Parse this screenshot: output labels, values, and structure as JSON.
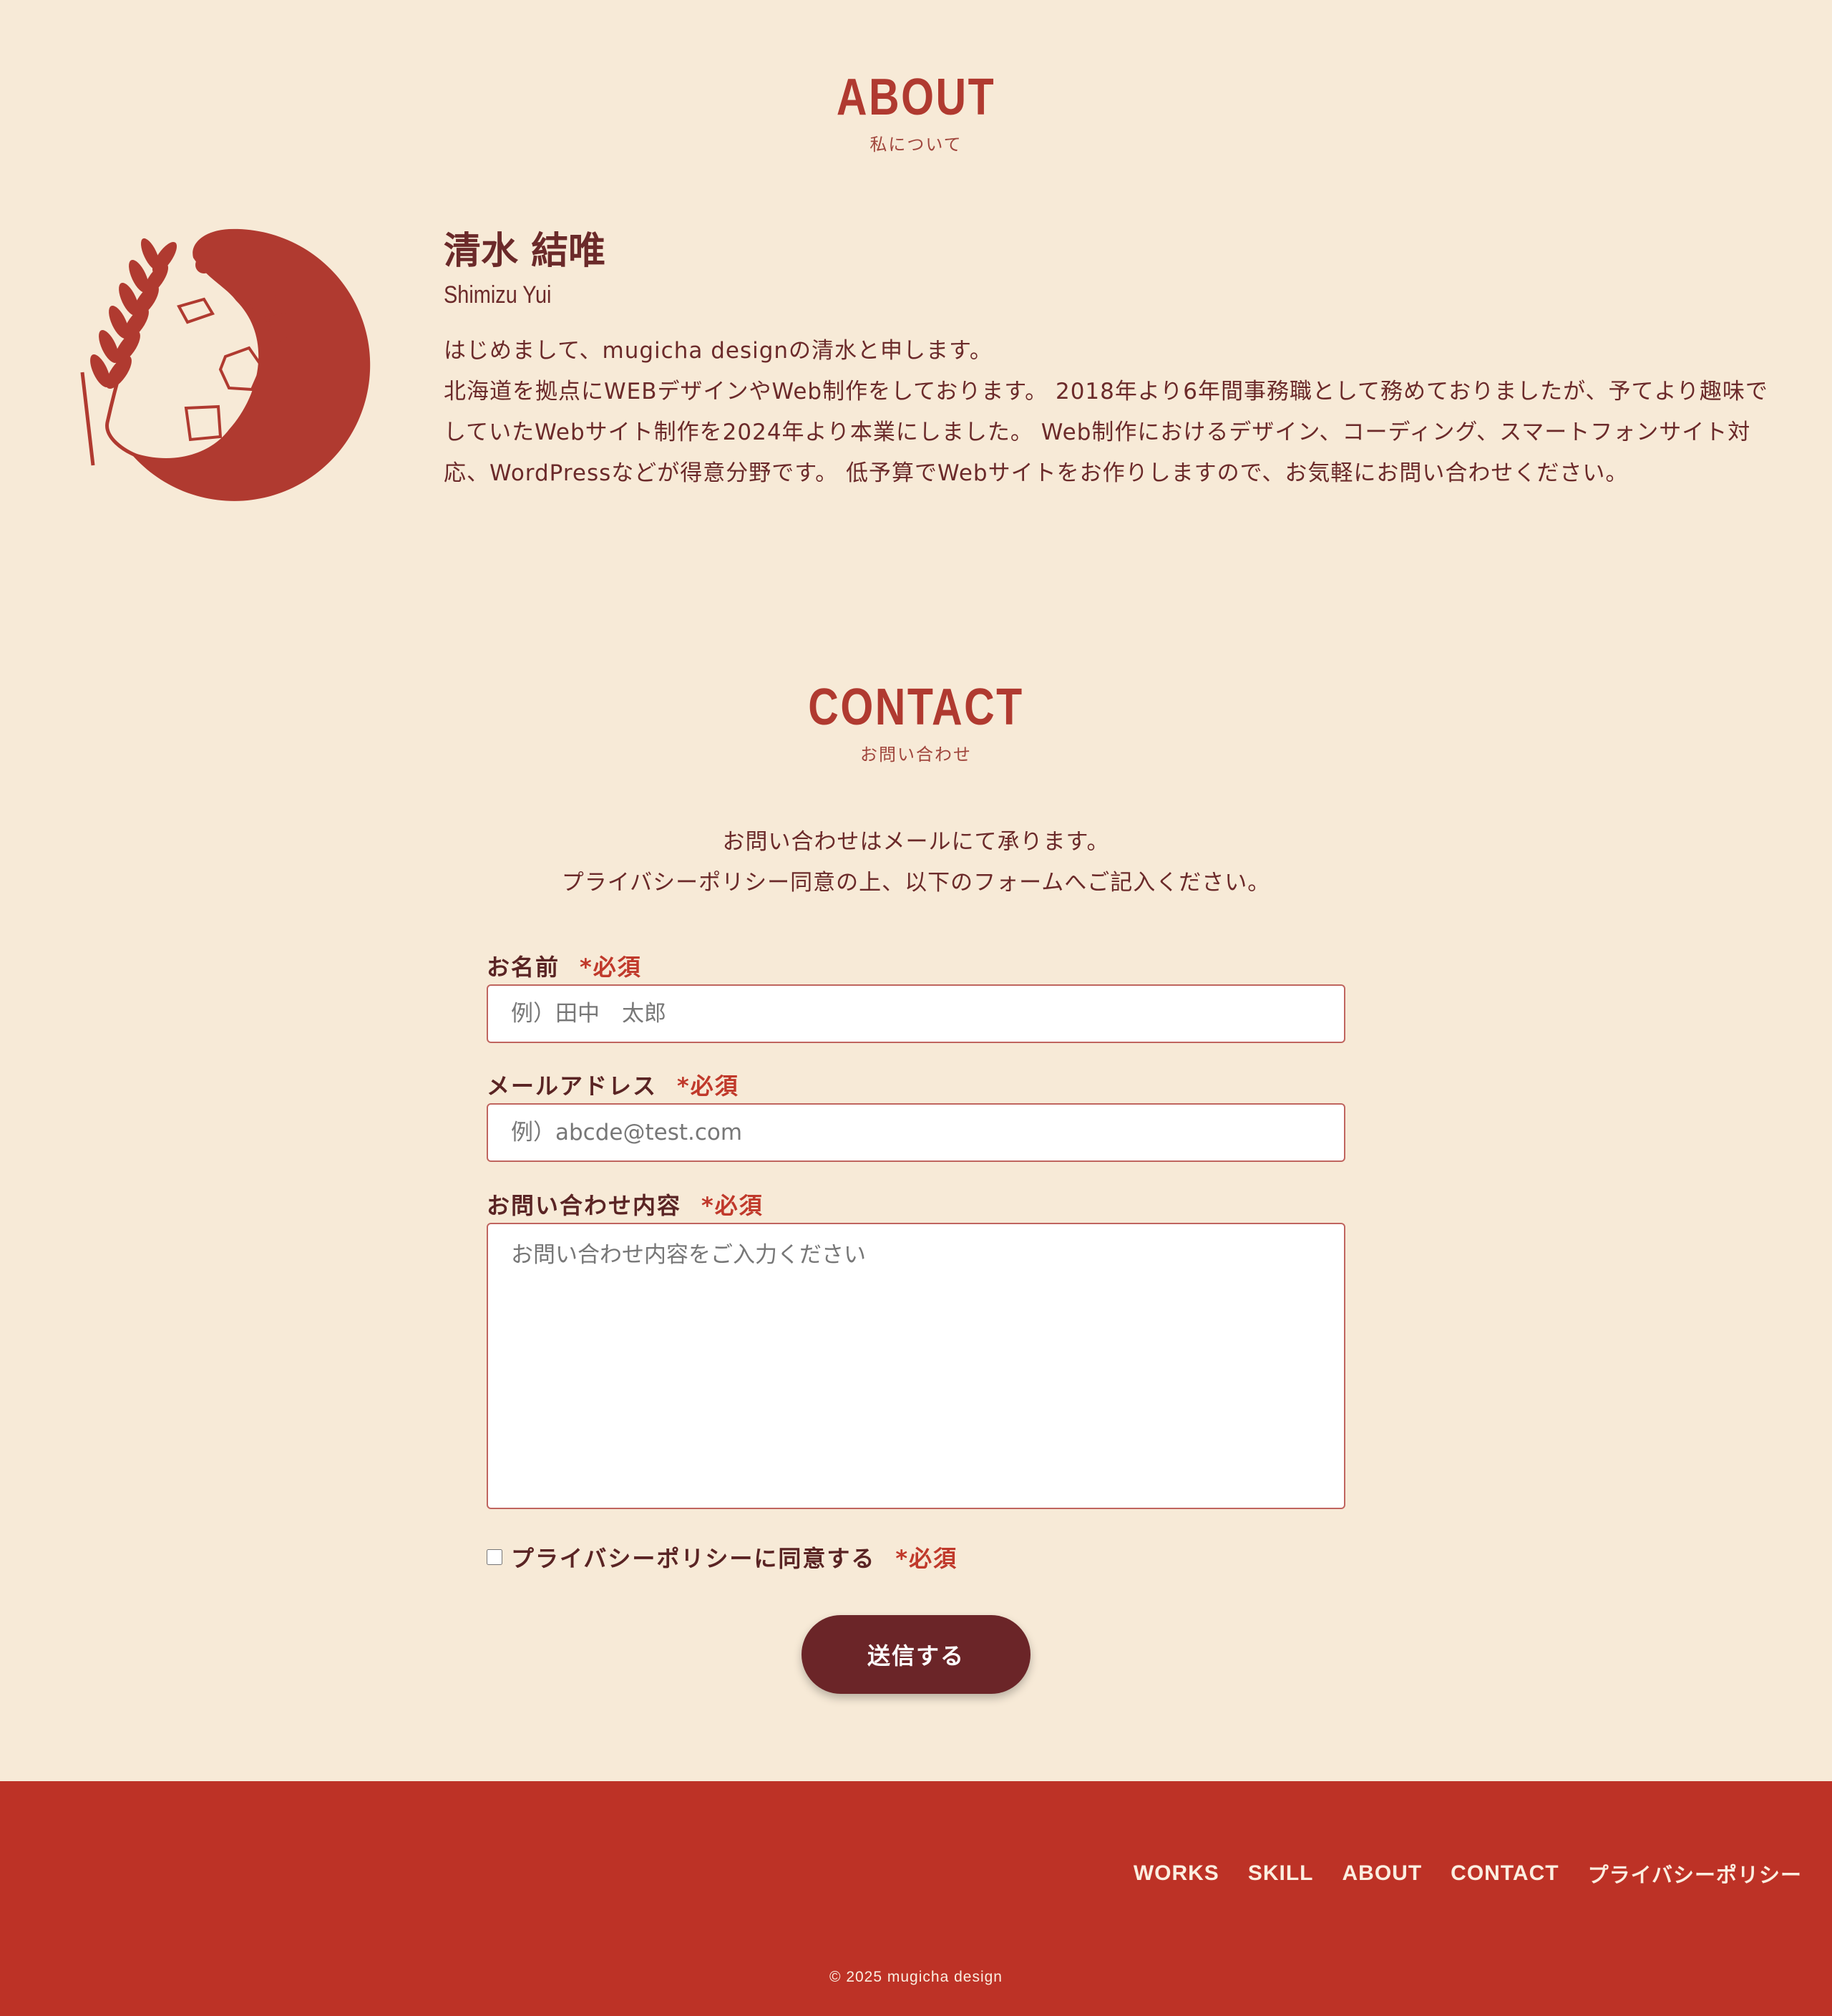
{
  "about": {
    "title": "ABOUT",
    "subtitle": "私について",
    "logo_icon": "wheat-tea-glass-icon",
    "name": "清水 結唯",
    "romaji": "Shimizu Yui",
    "paragraph_1": "はじめまして、mugicha designの清水と申します。",
    "paragraph_2": "北海道を拠点にWEBデザインやWeb制作をしております。 2018年より6年間事務職として務めておりましたが、予てより趣味でしていたWebサイト制作を2024年より本業にしました。 Web制作におけるデザイン、コーディング、スマートフォンサイト対応、WordPressなどが得意分野です。 低予算でWebサイトをお作りしますので、お気軽にお問い合わせください。"
  },
  "contact": {
    "title": "CONTACT",
    "subtitle": "お問い合わせ",
    "intro_line_1": "お問い合わせはメールにて承ります。",
    "intro_line_2": "プライバシーポリシー同意の上、以下のフォームへご記入ください。",
    "required_mark": "*必須",
    "name_label": "お名前",
    "name_placeholder": "例）田中　太郎",
    "email_label": "メールアドレス",
    "email_placeholder": "例）abcde@test.com",
    "message_label": "お問い合わせ内容",
    "message_placeholder": "お問い合わせ内容をご入力ください",
    "agree_label": "プライバシーポリシーに同意する",
    "submit_label": "送信する"
  },
  "footer": {
    "nav": [
      "WORKS",
      "SKILL",
      "ABOUT",
      "CONTACT",
      "プライバシーポリシー"
    ],
    "copyright": "© 2025 mugicha design"
  },
  "colors": {
    "background": "#f7ead7",
    "accent": "#b03a30",
    "text": "#6b2a2a",
    "button": "#6b2528",
    "footer": "#bd3226"
  }
}
